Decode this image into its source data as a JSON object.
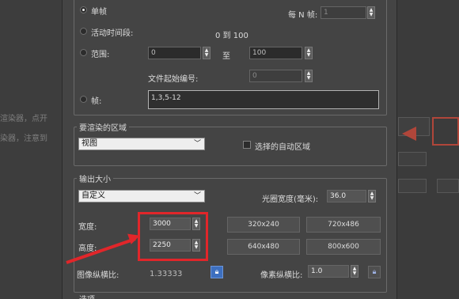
{
  "background": {
    "left_texts": [
      "渲染器，点开",
      "染器，注意到"
    ]
  },
  "time_output": {
    "single_frame_label": "单帧",
    "every_n_label": "每 N 帧:",
    "every_n_value": "1",
    "active_segment_label": "活动时间段:",
    "active_segment_range": "0 到 100",
    "range_label": "范围:",
    "range_from": "0",
    "range_to_label": "至",
    "range_to": "100",
    "file_start_label": "文件起始编号:",
    "file_start_value": "0",
    "frames_label": "帧:",
    "frames_value": "1,3,5-12"
  },
  "render_area": {
    "title": "要渲染的区域",
    "dropdown_value": "视图",
    "auto_region_label": "选择的自动区域"
  },
  "output_size": {
    "title": "输出大小",
    "preset_value": "自定义",
    "aperture_label": "光圈宽度(毫米):",
    "aperture_value": "36.0",
    "width_label": "宽度:",
    "width_value": "3000",
    "height_label": "高度:",
    "height_value": "2250",
    "presets": [
      "320x240",
      "720x486",
      "640x480",
      "800x600"
    ],
    "image_aspect_label": "图像纵横比:",
    "image_aspect_value": "1.33333",
    "pixel_aspect_label": "像素纵横比:",
    "pixel_aspect_value": "1.0"
  },
  "next_section_title": "选项",
  "icons": {
    "spinner": "up-down-arrows",
    "lock": "lock-icon"
  },
  "colors": {
    "annotation": "#e1262a",
    "lock_active": "#3d6fbf"
  }
}
